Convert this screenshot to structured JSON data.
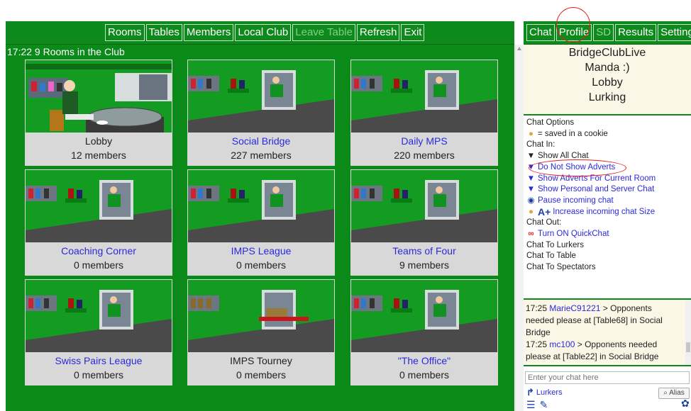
{
  "toolbar": {
    "buttons": [
      {
        "label": "Rooms"
      },
      {
        "label": "Tables"
      },
      {
        "label": "Members"
      },
      {
        "label": "Local Club"
      },
      {
        "label": "Leave Table"
      },
      {
        "label": "Refresh"
      },
      {
        "label": "Exit"
      }
    ]
  },
  "right_toolbar": {
    "buttons": [
      {
        "label": "Chat"
      },
      {
        "label": "Profile"
      },
      {
        "label": "SD"
      },
      {
        "label": "Results"
      },
      {
        "label": "Settings"
      }
    ]
  },
  "main": {
    "header": "17:22 9 Rooms in the Club",
    "rooms": [
      {
        "name": "Lobby",
        "members": "12 members"
      },
      {
        "name": "Social Bridge",
        "members": "227 members"
      },
      {
        "name": "Daily MPS",
        "members": "220 members"
      },
      {
        "name": "Coaching Corner",
        "members": "0 members"
      },
      {
        "name": "IMPS League",
        "members": "0 members"
      },
      {
        "name": "Teams of Four",
        "members": "9 members"
      },
      {
        "name": "Swiss Pairs League",
        "members": "0 members"
      },
      {
        "name": "IMPS Tourney",
        "members": "0 members"
      },
      {
        "name": "\"The Office\"",
        "members": "0 members"
      }
    ]
  },
  "info": {
    "line1": "BridgeClubLive",
    "line2": "Manda :)",
    "line3": "Lobby",
    "line4": "Lurking"
  },
  "chat_options": {
    "title": "Chat Options",
    "cookie_note": "= saved in a cookie",
    "chat_in": "Chat In:",
    "show_all": "Show All Chat",
    "no_adverts": "Do Not Show Adverts",
    "adverts_room": "Show Adverts For Current Room",
    "personal_server": "Show Personal and Server Chat",
    "pause": "Pause incoming chat",
    "increase": "Increase incoming chat Size",
    "chat_out": "Chat Out:",
    "quickchat": "Turn ON QuickChat",
    "to_lurkers": "Chat To Lurkers",
    "to_table": "Chat To Table",
    "to_spectators": "Chat To Spectators"
  },
  "messages": [
    {
      "time": "17:25",
      "user": "MarieC91221",
      "text": "> Opponents needed please at [Table68] in Social Bridge"
    },
    {
      "time": "17:25",
      "user": "mc100",
      "text": "> Opponents needed please at [Table22] in Social Bridge"
    }
  ],
  "chat_input": {
    "placeholder": "Enter your chat here"
  },
  "bottom": {
    "lurkers": "Lurkers",
    "alias": "Alias"
  },
  "colors": {
    "green": "#0e8a1c",
    "link": "#2a2adc",
    "annotation": "#e21b1b"
  }
}
